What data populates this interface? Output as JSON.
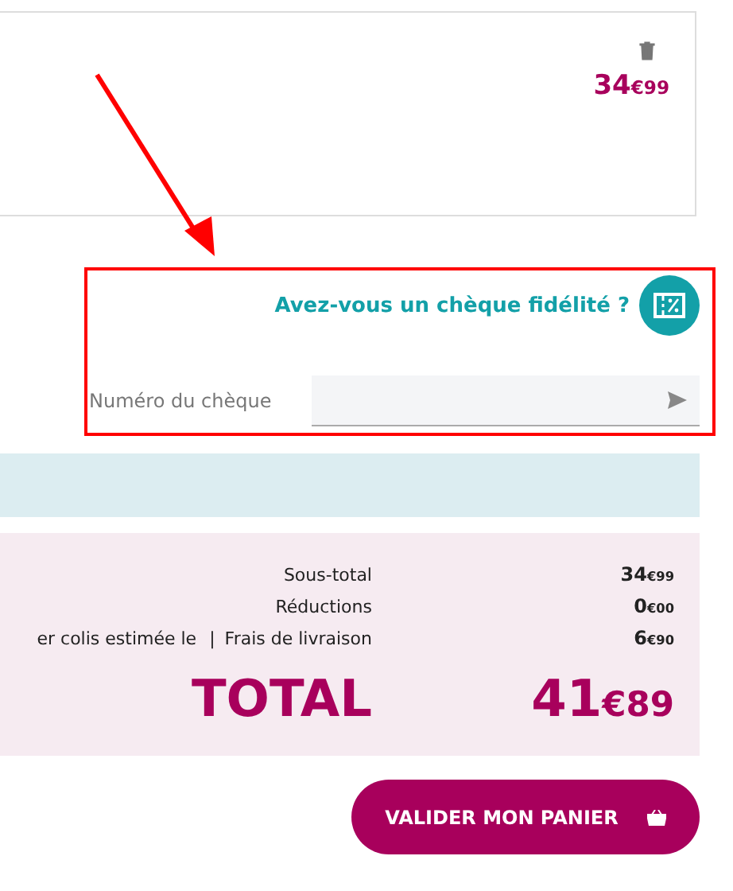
{
  "product": {
    "price": {
      "units": "34",
      "cents": "€99"
    }
  },
  "loyalty_cheque": {
    "question": "Avez-vous un chèque fidélité ?",
    "field": {
      "label": "Numéro du chèque"
    }
  },
  "summary": {
    "rows": [
      {
        "label": "Sous-total",
        "value": {
          "units": "34",
          "cents": "€99"
        }
      },
      {
        "label": "Réductions",
        "value": {
          "units": "0",
          "cents": "€00"
        }
      },
      {
        "note": "er colis estimée le",
        "separator": "|",
        "label": "Frais de livraison",
        "value": {
          "units": "6",
          "cents": "€90"
        }
      }
    ],
    "total": {
      "label": "TOTAL",
      "value": {
        "units": "41",
        "cents": "€89"
      }
    }
  },
  "checkout_button": {
    "label": "VALIDER MON PANIER"
  }
}
